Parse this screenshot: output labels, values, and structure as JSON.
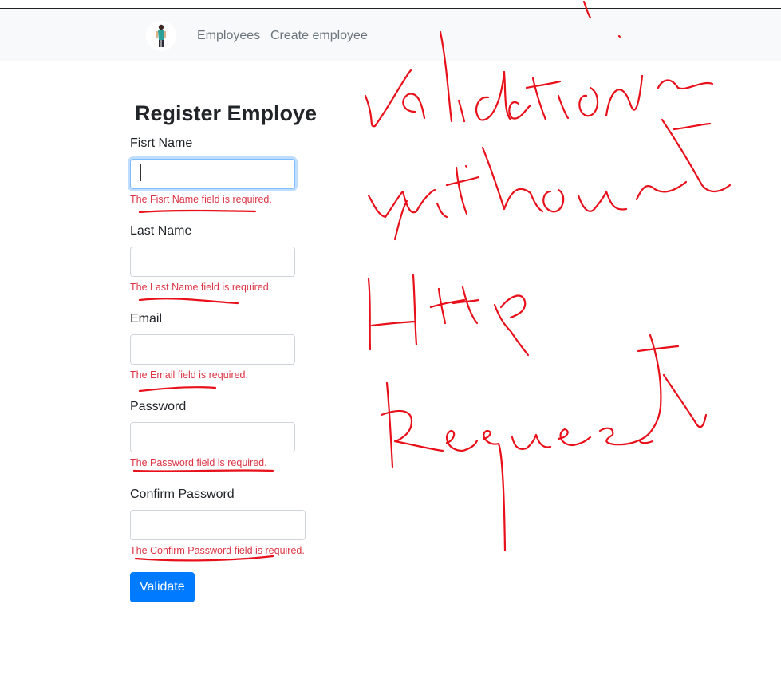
{
  "nav": {
    "avatar_icon": "person-avatar-icon",
    "links": [
      "Employees",
      "Create employee"
    ]
  },
  "form": {
    "title": "Register Employe",
    "fields": [
      {
        "label": "Fisrt Name",
        "value": "",
        "error": "The Fisrt Name field is required."
      },
      {
        "label": "Last Name",
        "value": "",
        "error": "The Last Name field is required."
      },
      {
        "label": "Email",
        "value": "",
        "error": "The Email field is required."
      },
      {
        "label": "Password",
        "value": "",
        "error": "The Password field is required."
      },
      {
        "label": "Confirm Password",
        "value": "",
        "error": "The Confirm Password field is required."
      }
    ],
    "submit_label": "Validate"
  },
  "annotation": {
    "handwritten_text": "Validation without Http Request",
    "color": "#e8101a"
  },
  "colors": {
    "primary": "#007bff",
    "error": "#dc3545",
    "navbar_bg": "#f8f9fa"
  }
}
